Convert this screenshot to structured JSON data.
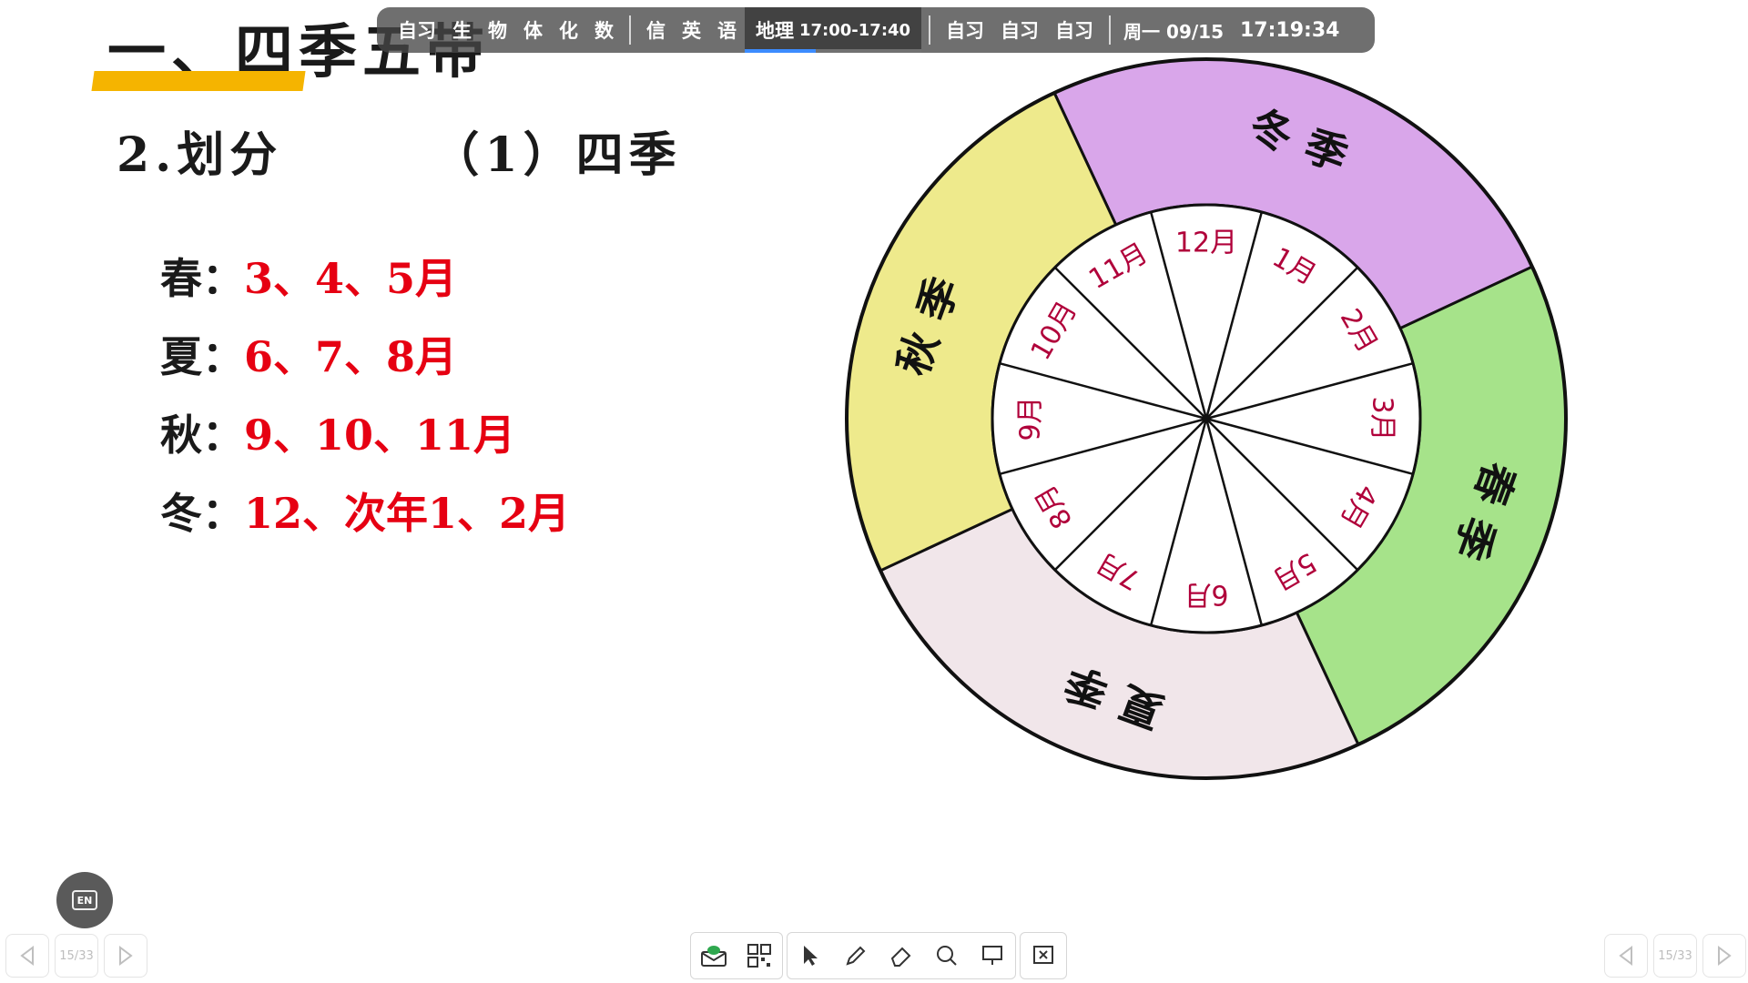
{
  "slide": {
    "title": "一、四季五带",
    "subtitle_left": "2.划分",
    "subtitle_right": "（1）四季",
    "seasons": [
      {
        "name": "春：",
        "months": "3、4、5月"
      },
      {
        "name": "夏：",
        "months": "6、7、8月"
      },
      {
        "name": "秋：",
        "months": "9、10、11月"
      },
      {
        "name": "冬：",
        "months": "12、次年1、2月"
      }
    ]
  },
  "schedule": {
    "items_a": [
      "自习",
      "生",
      "物",
      "体",
      "化",
      "数"
    ],
    "items_b": [
      "信",
      "英",
      "语"
    ],
    "current_subject": "地理",
    "current_time": "17:00-17:40",
    "current_progress": 0.4,
    "items_c": [
      "自习",
      "自习",
      "自习"
    ],
    "date": "周一 09/15",
    "clock": "17:19:34"
  },
  "diagram": {
    "season_labels": [
      "冬季",
      "春季",
      "夏季",
      "秋季"
    ],
    "month_labels": [
      "12月",
      "1月",
      "2月",
      "3月",
      "4月",
      "5月",
      "6月",
      "7月",
      "8月",
      "9月",
      "10月",
      "11月"
    ],
    "colors": {
      "winter": "#d9a6ea",
      "spring": "#a6e38a",
      "summer": "#f1e6ea",
      "autumn": "#eeea8c"
    }
  },
  "accent_colors": {
    "title_bar": "#f5b400",
    "months_text": "#e60012"
  },
  "pager": {
    "page": "15/33"
  },
  "en_label": "EN",
  "toolbar_icons": [
    "envelope-icon",
    "qr-code-icon",
    "pointer-icon",
    "pen-icon",
    "eraser-icon",
    "search-icon",
    "screen-icon",
    "close-screen-icon"
  ]
}
